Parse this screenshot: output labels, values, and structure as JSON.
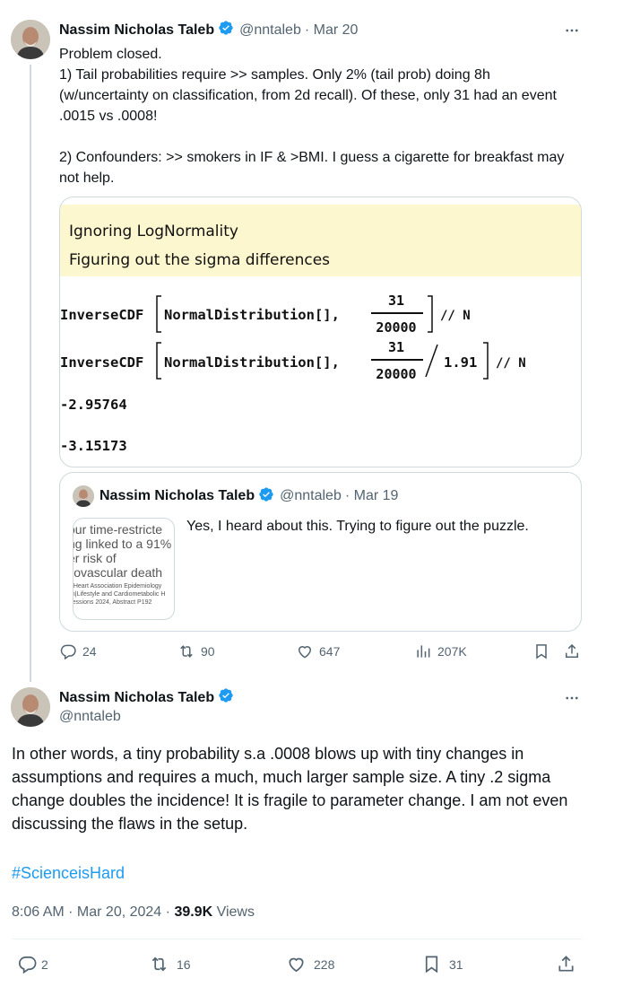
{
  "tweet1": {
    "author_name": "Nassim Nicholas Taleb",
    "handle": "@nntaleb",
    "date": "· Mar 20",
    "text_lines": [
      "Problem closed.",
      "1) Tail probabilities require >> samples. Only 2% (tail prob) doing 8h (w/uncertainty on classification, from 2d recall). Of these, only 31 had an event .0015 vs .0008!",
      "",
      "2) Confounders: >> smokers in IF & >BMI. I guess a cigarette for breakfast may not help."
    ],
    "image": {
      "note_line1": "Ignoring LogNormality",
      "note_line2": "Figuring out the sigma differences",
      "expr1_prefix": "InverseCDF",
      "expr1_arg": "NormalDistribution[],",
      "frac_num": "31",
      "frac_den": "20000",
      "expr_suffix": "// N",
      "divisor": "1.91",
      "result1": "-2.95764",
      "result2": "-3.15173"
    },
    "quote": {
      "author_name": "Nassim Nicholas Taleb",
      "handle": "@nntaleb",
      "date": "· Mar 19",
      "text": "Yes, I heard about this. Trying to figure out the puzzle.",
      "thumb_lines": [
        "our time-restricte",
        "ng linked to a 91%",
        "er risk of",
        "liovascular death"
      ],
      "thumb_small": [
        "n Heart Association Epidemiology",
        "on|Lifestyle and Cardiometabolic H",
        "Sessions 2024, Abstract P192"
      ]
    },
    "actions": {
      "replies": "24",
      "reposts": "90",
      "likes": "647",
      "views": "207K"
    }
  },
  "tweet2": {
    "author_name": "Nassim Nicholas Taleb",
    "handle": "@nntaleb",
    "text": "In other words, a tiny probability s.a .0008 blows up with tiny changes in assumptions and requires a much, much larger sample size. A tiny .2 sigma change doubles the incidence! It is fragile to parameter change. I am not even discussing the flaws in the setup.",
    "hashtag": "#ScienceisHard",
    "time": "8:06 AM · Mar 20, 2024 ·",
    "views_count": "39.9K",
    "views_label": "Views",
    "actions": {
      "replies": "2",
      "reposts": "16",
      "likes": "228",
      "bookmarks": "31"
    }
  },
  "colors": {
    "accent": "#1d9bf0",
    "secondary_text": "#536471",
    "border": "#cfd9de"
  },
  "icons": [
    "verified-badge-icon",
    "more-icon",
    "reply-icon",
    "repost-icon",
    "like-icon",
    "views-icon",
    "bookmark-icon",
    "share-icon"
  ]
}
